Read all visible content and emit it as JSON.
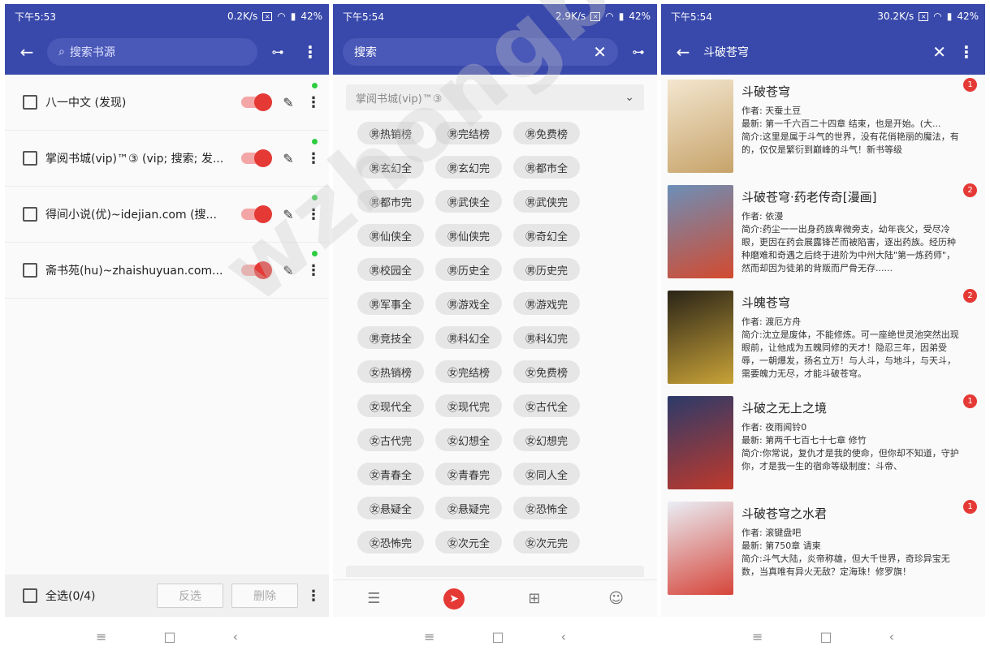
{
  "p1": {
    "status": {
      "time": "下午5:53",
      "speed": "0.2K/s",
      "battery": "42%"
    },
    "search_placeholder": "搜索书源",
    "sources": [
      {
        "name": "八一中文 (发现)"
      },
      {
        "name": "掌阅书城(vip)™③ (vip; 搜索; 发..."
      },
      {
        "name": "得间小说(优)~idejian.com (搜..."
      },
      {
        "name": "斋书苑(hu)~zhaishuyuan.com..."
      }
    ],
    "select_all": "全选(0/4)",
    "invert_label": "反选",
    "delete_label": "删除"
  },
  "p2": {
    "status": {
      "time": "下午5:54",
      "speed": "2.9K/s",
      "battery": "42%"
    },
    "search_text": "搜索",
    "group_title": "掌阅书城(vip)™③",
    "chips": [
      "㊚热销榜",
      "㊚完结榜",
      "㊚免费榜",
      "㊚玄幻全",
      "㊚玄幻完",
      "㊚都市全",
      "㊚都市完",
      "㊚武侠全",
      "㊚武侠完",
      "㊚仙侠全",
      "㊚仙侠完",
      "㊚奇幻全",
      "㊚校园全",
      "㊚历史全",
      "㊚历史完",
      "㊚军事全",
      "㊚游戏全",
      "㊚游戏完",
      "㊚竞技全",
      "㊚科幻全",
      "㊚科幻完",
      "㊛热销榜",
      "㊛完结榜",
      "㊛免费榜",
      "㊛现代全",
      "㊛现代完",
      "㊛古代全",
      "㊛古代完",
      "㊛幻想全",
      "㊛幻想完",
      "㊛青春全",
      "㊛青春完",
      "㊛同人全",
      "㊛悬疑全",
      "㊛悬疑完",
      "㊛恐怖全",
      "㊛恐怖完",
      "㊛次元全",
      "㊛次元完"
    ]
  },
  "p3": {
    "status": {
      "time": "下午5:54",
      "speed": "30.2K/s",
      "battery": "42%"
    },
    "search_text": "斗破苍穹",
    "books": [
      {
        "title": "斗破苍穹",
        "author": "作者: 天蚕土豆",
        "latest": "最新: 第一千六百二十四章 结束，也是开始。(大...",
        "intro": "简介:这里是属于斗气的世界，没有花俏艳丽的魔法，有的，仅仅是繁衍到巅峰的斗气！新书等级",
        "badge": "1",
        "c1": "#f3e6cf",
        "c2": "#c7a36a"
      },
      {
        "title": "斗破苍穹·药老传奇[漫画]",
        "author": "作者: 依漫",
        "latest": "",
        "intro": "简介:药尘一一出身药族卑微旁支，幼年丧父，受尽冷眼，更因在药会展露锋芒而被陷害，逐出药族。经历种种磨难和奇遇之后终于进阶为中州大陆\"第一炼药师\"，然而却因为徒弟的背叛而尸骨无存......",
        "badge": "2",
        "c1": "#6c8fb8",
        "c2": "#d34a2f"
      },
      {
        "title": "斗魄苍穹",
        "author": "作者: 渡厄方舟",
        "latest": "",
        "intro": "简介:沈立是废体，不能修炼。可一座绝世灵池突然出现眼前，让他成为五魄同修的天才！隐忍三年，因弟受辱，一朝爆发，扬名立万！与人斗，与地斗，与天斗，需要魄力无尽，才能斗破苍穹。",
        "badge": "2",
        "c1": "#2a2418",
        "c2": "#c9a338"
      },
      {
        "title": "斗破之无上之境",
        "author": "作者: 夜雨闻铃0",
        "latest": "最新: 第两千七百七十七章 修竹",
        "intro": "简介:你常说，复仇才是我的使命，但你却不知道，守护你，才是我一生的宿命等级制度：斗帝、",
        "badge": "1",
        "c1": "#2b3a6a",
        "c2": "#c0392b"
      },
      {
        "title": "斗破苍穹之水君",
        "author": "作者: 滚键盘吧",
        "latest": "最新: 第750章 请柬",
        "intro": "简介:斗气大陆，炎帝称雄，但大千世界，奇珍异宝无数，当真唯有异火无敌？定海珠！修罗旗！",
        "badge": "1",
        "c1": "#e9eef5",
        "c2": "#d6453a"
      }
    ]
  },
  "watermark": "wzhongbei.com",
  "colors": {
    "primary": "#3949ab",
    "accent": "#e53935",
    "online": "#2ecc40"
  }
}
